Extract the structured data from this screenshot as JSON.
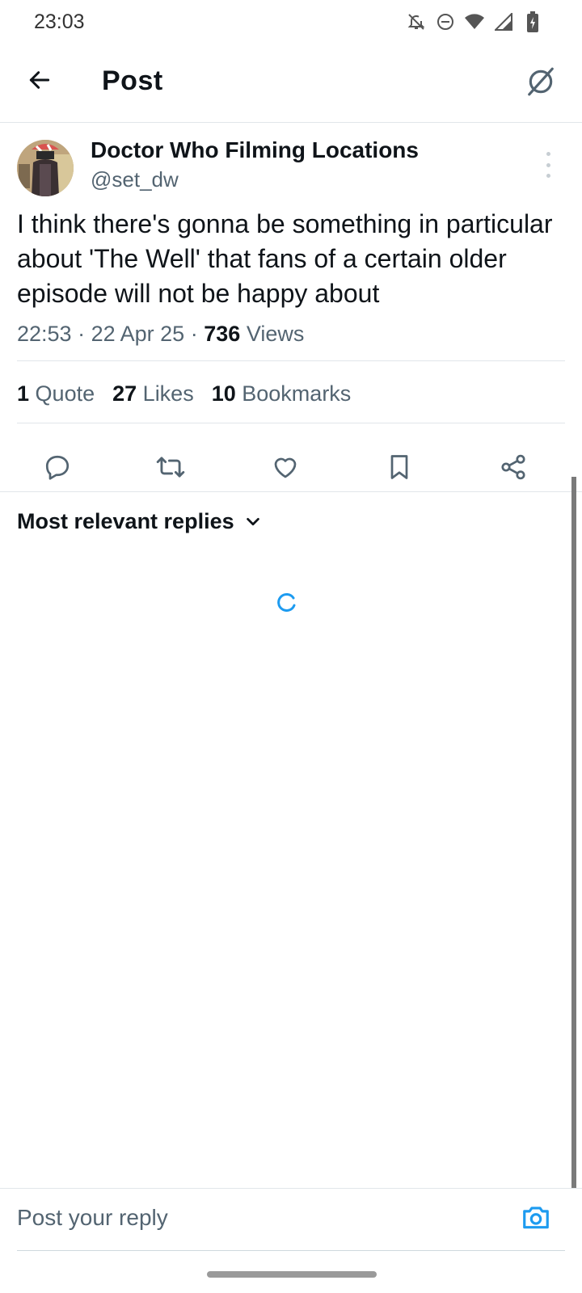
{
  "status_bar": {
    "time": "23:03",
    "icons": [
      "bell-off-icon",
      "do-not-disturb-icon",
      "wifi-icon",
      "signal-icon",
      "battery-charging-icon"
    ]
  },
  "header": {
    "title": "Post",
    "back_icon": "arrow-left-icon",
    "grok_icon": "grok-icon"
  },
  "post": {
    "author_name": "Doctor Who Filming Locations",
    "author_handle": "@set_dw",
    "text": "I think there's gonna be something in particular about 'The Well' that fans of a certain older episode will not be happy about",
    "time": "22:53",
    "date": "22 Apr 25",
    "views_count": "736",
    "views_label": "Views",
    "separator": "·"
  },
  "stats": {
    "quotes_count": "1",
    "quotes_label": "Quote",
    "likes_count": "27",
    "likes_label": "Likes",
    "bookmarks_count": "10",
    "bookmarks_label": "Bookmarks"
  },
  "actions": [
    "reply-icon",
    "repost-icon",
    "like-icon",
    "bookmark-icon",
    "share-icon"
  ],
  "replies": {
    "sort_label": "Most relevant replies"
  },
  "reply_bar": {
    "placeholder": "Post your reply"
  },
  "colors": {
    "accent": "#1d9bf0",
    "text_primary": "#0f1419",
    "text_secondary": "#536471",
    "divider": "#e1e6ea"
  }
}
